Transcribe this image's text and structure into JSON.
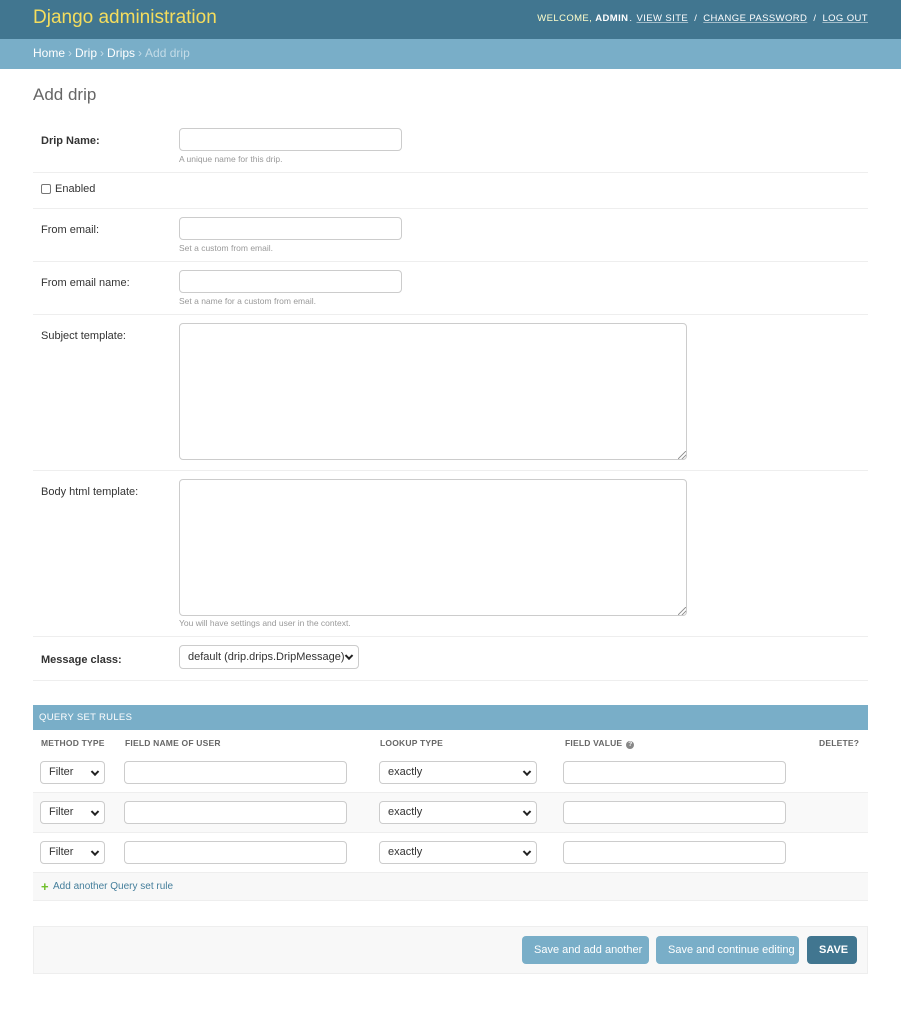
{
  "header": {
    "brand": "Django administration",
    "welcome": "WELCOME,",
    "user": "ADMIN",
    "view_site": "VIEW SITE",
    "change_password": "CHANGE PASSWORD",
    "log_out": "LOG OUT",
    "separator": "/"
  },
  "breadcrumbs": {
    "home": "Home",
    "app": "Drip",
    "model": "Drips",
    "current": "Add drip",
    "arrow": "›"
  },
  "page_title": "Add drip",
  "form": {
    "drip_name": {
      "label": "Drip Name:",
      "value": "",
      "help": "A unique name for this drip."
    },
    "enabled": {
      "label": "Enabled",
      "checked": false
    },
    "from_email": {
      "label": "From email:",
      "value": "",
      "help": "Set a custom from email."
    },
    "from_email_name": {
      "label": "From email name:",
      "value": "",
      "help": "Set a name for a custom from email."
    },
    "subject_template": {
      "label": "Subject template:",
      "value": ""
    },
    "body_html_template": {
      "label": "Body html template:",
      "value": "",
      "help": "You will have settings and user in the context."
    },
    "message_class": {
      "label": "Message class:",
      "selected": "default (drip.drips.DripMessage)"
    }
  },
  "inline": {
    "title": "QUERY SET RULES",
    "columns": [
      "METHOD TYPE",
      "FIELD NAME OF USER",
      "LOOKUP TYPE",
      "FIELD VALUE",
      "DELETE?"
    ],
    "help_glyph": "?",
    "rows": [
      {
        "method_type": "Filter",
        "field_name": "",
        "lookup_type": "exactly",
        "field_value": ""
      },
      {
        "method_type": "Filter",
        "field_name": "",
        "lookup_type": "exactly",
        "field_value": ""
      },
      {
        "method_type": "Filter",
        "field_name": "",
        "lookup_type": "exactly",
        "field_value": ""
      }
    ],
    "add_another_icon": "+",
    "add_another": "Add another Query set rule"
  },
  "submit": {
    "save_add_another": "Save and add another",
    "save_continue": "Save and continue editing",
    "save": "SAVE"
  },
  "colors": {
    "header_bg": "#417690",
    "brand": "#f5dd5d",
    "breadcrumb_bg": "#79aec8",
    "button_bg": "#79aec8",
    "default_button_bg": "#417690",
    "add_icon": "#70bf2b",
    "link": "#447e9b"
  }
}
